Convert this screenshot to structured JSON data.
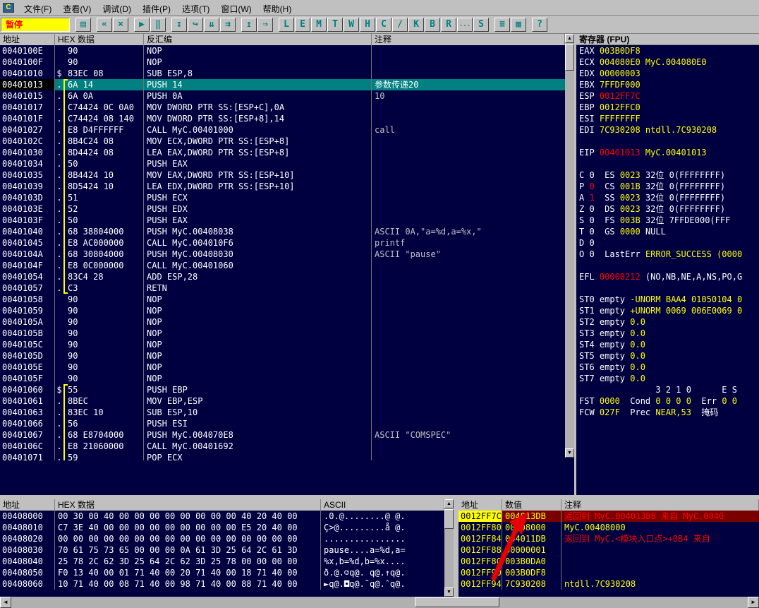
{
  "app": {
    "icon_letter": "C"
  },
  "icons": {
    "up": "▲",
    "down": "▼",
    "left": "◄",
    "right": "►"
  },
  "menu": {
    "items": [
      {
        "id": "file",
        "label": "文件(F)"
      },
      {
        "id": "view",
        "label": "查看(V)"
      },
      {
        "id": "debug",
        "label": "调试(D)"
      },
      {
        "id": "plugins",
        "label": "插件(P)"
      },
      {
        "id": "options",
        "label": "选项(T)"
      },
      {
        "id": "window",
        "label": "窗口(W)"
      },
      {
        "id": "help",
        "label": "帮助(H)"
      }
    ]
  },
  "toolbar": {
    "status": "暂停",
    "groups": [
      {
        "buttons": [
          {
            "id": "open",
            "glyph": "▤"
          }
        ]
      },
      {
        "buttons": [
          {
            "id": "restart",
            "glyph": "«"
          },
          {
            "id": "close",
            "glyph": "×"
          }
        ]
      },
      {
        "buttons": [
          {
            "id": "run",
            "glyph": "▶"
          },
          {
            "id": "pause",
            "glyph": "‖"
          }
        ]
      },
      {
        "buttons": [
          {
            "id": "step-into",
            "glyph": "↧"
          },
          {
            "id": "step-over",
            "glyph": "↪"
          },
          {
            "id": "animate-into",
            "glyph": "⇊"
          },
          {
            "id": "animate-over",
            "glyph": "⇉"
          }
        ]
      },
      {
        "buttons": [
          {
            "id": "until-return",
            "glyph": "↥"
          },
          {
            "id": "goto",
            "glyph": "⇒"
          }
        ]
      },
      {
        "buttons": [
          {
            "id": "view-log",
            "glyph": "L"
          },
          {
            "id": "view-executables",
            "glyph": "E"
          },
          {
            "id": "view-memory",
            "glyph": "M"
          },
          {
            "id": "view-threads",
            "glyph": "T"
          },
          {
            "id": "view-windows",
            "glyph": "W"
          },
          {
            "id": "view-handles",
            "glyph": "H"
          },
          {
            "id": "view-cpu",
            "glyph": "C"
          },
          {
            "id": "view-patches",
            "glyph": "/"
          },
          {
            "id": "view-call-stack",
            "glyph": "K"
          },
          {
            "id": "view-breakpoints",
            "glyph": "B"
          },
          {
            "id": "view-references",
            "glyph": "R"
          },
          {
            "id": "view-run-trace",
            "glyph": "..."
          },
          {
            "id": "view-source",
            "glyph": "S"
          }
        ]
      },
      {
        "buttons": [
          {
            "id": "appearance",
            "glyph": "≡"
          },
          {
            "id": "windows-list",
            "glyph": "▦"
          }
        ]
      },
      {
        "buttons": [
          {
            "id": "help",
            "glyph": "?"
          }
        ]
      }
    ]
  },
  "disasm": {
    "headers": [
      "地址",
      "HEX 数据",
      "反汇编",
      "注释"
    ],
    "rows": [
      [
        "0040100E",
        "",
        "90",
        "NOP",
        "",
        "",
        ""
      ],
      [
        "0040100F",
        "",
        "90",
        "NOP",
        "",
        "",
        ""
      ],
      [
        "00401010",
        "$",
        "83EC 08",
        "SUB ESP,8",
        "",
        "",
        ""
      ],
      [
        "00401013",
        ".",
        "6A 14",
        "PUSH 14",
        "参数传递20",
        "sel",
        "bs"
      ],
      [
        "00401015",
        ".",
        "6A 0A",
        "PUSH 0A",
        "10",
        "",
        "bm"
      ],
      [
        "00401017",
        ".",
        "C74424 0C 0A0",
        "MOV DWORD PTR SS:[ESP+C],0A",
        "",
        "",
        "bm"
      ],
      [
        "0040101F",
        ".",
        "C74424 08 140",
        "MOV DWORD PTR SS:[ESP+8],14",
        "",
        "",
        "bm"
      ],
      [
        "00401027",
        ".",
        "E8 D4FFFFFF",
        "CALL MyC.00401000",
        "call",
        "",
        "bm"
      ],
      [
        "0040102C",
        ".",
        "8B4C24 08",
        "MOV ECX,DWORD PTR SS:[ESP+8]",
        "",
        "",
        "bm"
      ],
      [
        "00401030",
        ".",
        "8D4424 08",
        "LEA EAX,DWORD PTR SS:[ESP+8]",
        "",
        "",
        "bm"
      ],
      [
        "00401034",
        ".",
        "50",
        "PUSH EAX",
        "",
        "",
        "bm"
      ],
      [
        "00401035",
        ".",
        "8B4424 10",
        "MOV EAX,DWORD PTR SS:[ESP+10]",
        "",
        "",
        "bm"
      ],
      [
        "00401039",
        ".",
        "8D5424 10",
        "LEA EDX,DWORD PTR SS:[ESP+10]",
        "",
        "",
        "bm"
      ],
      [
        "0040103D",
        ".",
        "51",
        "PUSH ECX",
        "",
        "",
        "bm"
      ],
      [
        "0040103E",
        ".",
        "52",
        "PUSH EDX",
        "",
        "",
        "bm"
      ],
      [
        "0040103F",
        ".",
        "50",
        "PUSH EAX",
        "",
        "",
        "bm"
      ],
      [
        "00401040",
        ".",
        "68 38804000",
        "PUSH MyC.00408038",
        "ASCII 0A,\"a=%d,a=%x,\"",
        "",
        "bm"
      ],
      [
        "00401045",
        ".",
        "E8 AC000000",
        "CALL MyC.004010F6",
        "printf",
        "",
        "bm"
      ],
      [
        "0040104A",
        ".",
        "68 30804000",
        "PUSH MyC.00408030",
        "ASCII \"pause\"",
        "",
        "bm"
      ],
      [
        "0040104F",
        ".",
        "E8 0C000000",
        "CALL MyC.00401060",
        "",
        "",
        "bm"
      ],
      [
        "00401054",
        ".",
        "83C4 28",
        "ADD ESP,28",
        "",
        "",
        "bm"
      ],
      [
        "00401057",
        ".",
        "C3",
        "RETN",
        "",
        "",
        "be"
      ],
      [
        "00401058",
        "",
        "90",
        "NOP",
        "",
        "",
        ""
      ],
      [
        "00401059",
        "",
        "90",
        "NOP",
        "",
        "",
        ""
      ],
      [
        "0040105A",
        "",
        "90",
        "NOP",
        "",
        "",
        ""
      ],
      [
        "0040105B",
        "",
        "90",
        "NOP",
        "",
        "",
        ""
      ],
      [
        "0040105C",
        "",
        "90",
        "NOP",
        "",
        "",
        ""
      ],
      [
        "0040105D",
        "",
        "90",
        "NOP",
        "",
        "",
        ""
      ],
      [
        "0040105E",
        "",
        "90",
        "NOP",
        "",
        "",
        ""
      ],
      [
        "0040105F",
        "",
        "90",
        "NOP",
        "",
        "",
        ""
      ],
      [
        "00401060",
        "$",
        "55",
        "PUSH EBP",
        "",
        "",
        "bs"
      ],
      [
        "00401061",
        ".",
        "8BEC",
        "MOV EBP,ESP",
        "",
        "",
        "bm"
      ],
      [
        "00401063",
        ".",
        "83EC 10",
        "SUB ESP,10",
        "",
        "",
        "bm"
      ],
      [
        "00401066",
        ".",
        "56",
        "PUSH ESI",
        "",
        "",
        "bm"
      ],
      [
        "00401067",
        ".",
        "68 E8704000",
        "PUSH MyC.004070E8",
        "ASCII \"COMSPEC\"",
        "",
        "bm"
      ],
      [
        "0040106C",
        ".",
        "E8 21060000",
        "CALL MyC.00401692",
        "",
        "",
        "bm"
      ],
      [
        "00401071",
        ".",
        "59",
        "POP ECX",
        "",
        "",
        "bm"
      ]
    ]
  },
  "registers": {
    "title": "寄存器 (FPU)",
    "lines": [
      [
        [
          "EAX ",
          "w"
        ],
        [
          "003B0DF8",
          "y"
        ]
      ],
      [
        [
          "ECX ",
          "w"
        ],
        [
          "004080E0",
          "y"
        ],
        [
          " MyC.004080E0",
          "y"
        ]
      ],
      [
        [
          "EDX ",
          "w"
        ],
        [
          "00000003",
          "y"
        ]
      ],
      [
        [
          "EBX ",
          "w"
        ],
        [
          "7FFDF000",
          "y"
        ]
      ],
      [
        [
          "ESP ",
          "w"
        ],
        [
          "0012FF7C",
          "r"
        ]
      ],
      [
        [
          "EBP ",
          "w"
        ],
        [
          "0012FFC0",
          "y"
        ]
      ],
      [
        [
          "ESI ",
          "w"
        ],
        [
          "FFFFFFFF",
          "y"
        ]
      ],
      [
        [
          "EDI ",
          "w"
        ],
        [
          "7C930208",
          "y"
        ],
        [
          " ntdll.7C930208",
          "y"
        ]
      ],
      [],
      [
        [
          "EIP ",
          "w"
        ],
        [
          "00401013",
          "r"
        ],
        [
          " MyC.00401013",
          "y"
        ]
      ],
      [],
      [
        [
          "C 0",
          "w"
        ],
        [
          "  ES ",
          "w"
        ],
        [
          "0023",
          "y"
        ],
        [
          " 32位 0(FFFFFFFF)",
          "w"
        ]
      ],
      [
        [
          "P ",
          "w"
        ],
        [
          "0",
          "r"
        ],
        [
          "  CS ",
          "w"
        ],
        [
          "001B",
          "y"
        ],
        [
          " 32位 0(FFFFFFFF)",
          "w"
        ]
      ],
      [
        [
          "A ",
          "w"
        ],
        [
          "1",
          "r"
        ],
        [
          "  SS ",
          "w"
        ],
        [
          "0023",
          "y"
        ],
        [
          " 32位 0(FFFFFFFF)",
          "w"
        ]
      ],
      [
        [
          "Z 0",
          "w"
        ],
        [
          "  DS ",
          "w"
        ],
        [
          "0023",
          "y"
        ],
        [
          " 32位 0(FFFFFFFF)",
          "w"
        ]
      ],
      [
        [
          "S 0",
          "w"
        ],
        [
          "  FS ",
          "w"
        ],
        [
          "003B",
          "y"
        ],
        [
          " 32位 7FFDE000(FFF",
          "w"
        ]
      ],
      [
        [
          "T 0",
          "w"
        ],
        [
          "  GS ",
          "w"
        ],
        [
          "0000",
          "y"
        ],
        [
          " NULL",
          "w"
        ]
      ],
      [
        [
          "D 0",
          "w"
        ]
      ],
      [
        [
          "O 0",
          "w"
        ],
        [
          "  LastErr ",
          "w"
        ],
        [
          "ERROR_SUCCESS (0000",
          "y"
        ]
      ],
      [],
      [
        [
          "EFL ",
          "w"
        ],
        [
          "00000212",
          "r"
        ],
        [
          " (NO,NB,NE,A,NS,PO,G",
          "w"
        ]
      ],
      [],
      [
        [
          "ST0 ",
          "w"
        ],
        [
          "empty ",
          "w"
        ],
        [
          "-UNORM BAA4 01050104 0",
          "y"
        ]
      ],
      [
        [
          "ST1 ",
          "w"
        ],
        [
          "empty ",
          "w"
        ],
        [
          "+UNORM 0069 006E0069 0",
          "y"
        ]
      ],
      [
        [
          "ST2 ",
          "w"
        ],
        [
          "empty ",
          "w"
        ],
        [
          "0.0",
          "y"
        ]
      ],
      [
        [
          "ST3 ",
          "w"
        ],
        [
          "empty ",
          "w"
        ],
        [
          "0.0",
          "y"
        ]
      ],
      [
        [
          "ST4 ",
          "w"
        ],
        [
          "empty ",
          "w"
        ],
        [
          "0.0",
          "y"
        ]
      ],
      [
        [
          "ST5 ",
          "w"
        ],
        [
          "empty ",
          "w"
        ],
        [
          "0.0",
          "y"
        ]
      ],
      [
        [
          "ST6 ",
          "w"
        ],
        [
          "empty ",
          "w"
        ],
        [
          "0.0",
          "y"
        ]
      ],
      [
        [
          "ST7 ",
          "w"
        ],
        [
          "empty ",
          "w"
        ],
        [
          "0.0",
          "y"
        ]
      ],
      [
        [
          "               3 2 1 0      E S",
          "w"
        ]
      ],
      [
        [
          "FST ",
          "w"
        ],
        [
          "0000",
          "y"
        ],
        [
          "  Cond ",
          "w"
        ],
        [
          "0 0 0 0",
          "y"
        ],
        [
          "  Err ",
          "w"
        ],
        [
          "0 0",
          "y"
        ]
      ],
      [
        [
          "FCW ",
          "w"
        ],
        [
          "027F",
          "y"
        ],
        [
          "  Prec ",
          "w"
        ],
        [
          "NEAR,53",
          "y"
        ],
        [
          "  掩码",
          "w"
        ]
      ]
    ]
  },
  "dump": {
    "headers": [
      "地址",
      "HEX 数据",
      "ASCII"
    ],
    "rows": [
      {
        "addr": "00408000",
        "bytes": "00 30 00 40 00 00 00 00 00 00 00 00 40 20 40 00",
        "ascii": ".0.@........@ @."
      },
      {
        "addr": "00408010",
        "bytes": "C7 3E 40 00 00 00 00 00 00 00 00 00 E5 20 40 00",
        "ascii": "Ç>@.........å @."
      },
      {
        "addr": "00408020",
        "bytes": "00 00 00 00 00 00 00 00 00 00 00 00 00 00 00 00",
        "ascii": "................"
      },
      {
        "addr": "00408030",
        "bytes": "70 61 75 73 65 00 00 00 0A 61 3D 25 64 2C 61 3D",
        "ascii": "pause....a=%d,a="
      },
      {
        "addr": "00408040",
        "bytes": "25 78 2C 62 3D 25 64 2C 62 3D 25 78 00 00 00 00",
        "ascii": "%x,b=%d,b=%x...."
      },
      {
        "addr": "00408050",
        "bytes": "F0 13 40 00 01 71 40 00 20 71 40 00 18 71 40 00",
        "ascii": "ð.@.☺q@. q@.↑q@."
      },
      {
        "addr": "00408060",
        "bytes": "10 71 40 00 08 71 40 00 98 71 40 00 88 71 40 00",
        "ascii": "►q@.◘q@.˜q@.ˆq@."
      }
    ]
  },
  "stack": {
    "headers": [
      "地址",
      "数值",
      "注释"
    ],
    "rows": [
      {
        "addr": "0012FF7C",
        "value": "004013DB",
        "cmt": "返回到 MyC.004013DB 来自 MyC.0040",
        "cmtc": "red",
        "sel": true
      },
      {
        "addr": "0012FF80",
        "value": "00408000",
        "cmt": "MyC.00408000",
        "cmtc": "yellow"
      },
      {
        "addr": "0012FF84",
        "value": "004011DB",
        "cmt": "返回到 MyC.<模块入口点>+0B4 来自",
        "cmtc": "red"
      },
      {
        "addr": "0012FF88",
        "value": "00000001",
        "cmt": ""
      },
      {
        "addr": "0012FF8C",
        "value": "003B0DA0",
        "cmt": ""
      },
      {
        "addr": "0012FF90",
        "value": "003B0DF8",
        "cmt": ""
      },
      {
        "addr": "0012FF94",
        "value": "7C930208",
        "cmt": "ntdll.7C930208",
        "cmtc": "yellow"
      }
    ]
  }
}
